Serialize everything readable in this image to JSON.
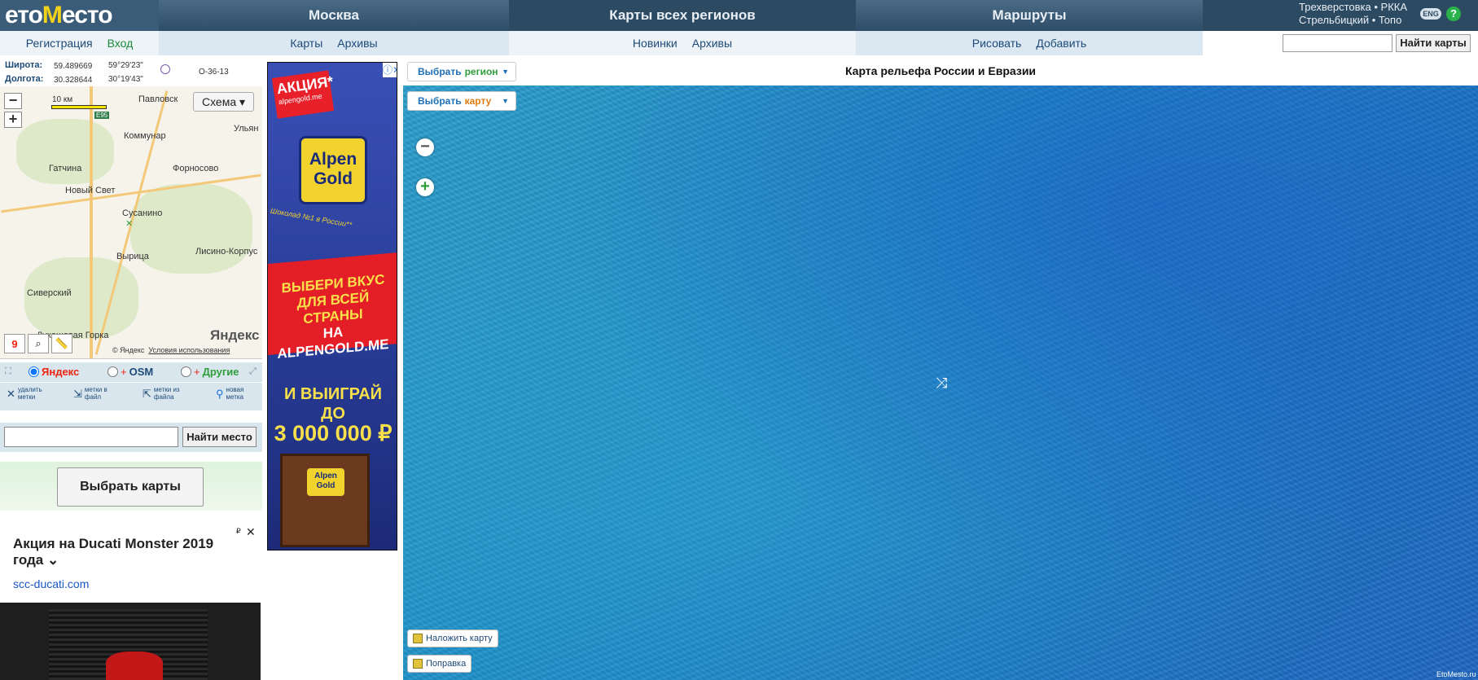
{
  "logo": {
    "text_pre": "е",
    "text_mid": "то",
    "text_hl": "М",
    "text_post": "есто"
  },
  "nav": {
    "moscow": "Москва",
    "all_regions": "Карты всех регионов",
    "routes": "Маршруты",
    "top_right_1": "Трехверстовка • РККА",
    "top_right_2": "Стрельбицкий • Топо",
    "eng": "ENG",
    "help": "?"
  },
  "subnav": {
    "register": "Регистрация",
    "login": "Вход",
    "maps": "Карты",
    "archives1": "Архивы",
    "news": "Новинки",
    "archives2": "Архивы",
    "draw": "Рисовать",
    "add": "Добавить",
    "search_btn": "Найти карты"
  },
  "coords": {
    "lat_label": "Широта:",
    "lat_dec": "59.489669",
    "lat_dms": "59°29'23\"",
    "lon_label": "Долгота:",
    "lon_dec": "30.328644",
    "lon_dms": "30°19'43\"",
    "sheet": "O-36-13"
  },
  "minimap": {
    "scale": "10 км",
    "road": "E95",
    "schema": "Схема ▾",
    "towns": [
      "Павловск",
      "Ульян",
      "Коммунар",
      "Гатчина",
      "Форносово",
      "Новый Свет",
      "Сусанино",
      "Вырица",
      "Лисино-Корпус",
      "Сиверский",
      "Лукашовая Горка"
    ],
    "logo": "Яндекс",
    "copy": "© Яндекс",
    "terms": "Условия использования"
  },
  "providers": {
    "yandex": "Яндекс",
    "osm": "OSM",
    "other": "Другие"
  },
  "tools": [
    {
      "l1": "удалить",
      "l2": "метки"
    },
    {
      "l1": "метки в",
      "l2": "файл"
    },
    {
      "l1": "метки из",
      "l2": "файла"
    },
    {
      "l1": "новая",
      "l2": "метка"
    }
  ],
  "place": {
    "btn": "Найти место"
  },
  "choose_maps": "Выбрать карты",
  "ad": {
    "title": "Акция на Ducati Monster 2019 года",
    "url": "scc-ducati.com",
    "mark": "₽",
    "close": "✕"
  },
  "banner": {
    "akc": "АКЦИЯ*",
    "akc_site": "alpengold.me",
    "brand1": "Alpen",
    "brand2": "Gold",
    "slogan": "Шоколад №1 в России**",
    "red1": "ВЫБЕРИ ВКУС",
    "red2": "ДЛЯ ВСЕЙ СТРАНЫ",
    "red3": "НА ALPENGOLD.ME",
    "win1": "И ВЫИГРАЙ ДО",
    "win2": "3 000 000 ₽",
    "choc": "Alpen Gold",
    "ad_icons": "ⓘ✕"
  },
  "map": {
    "title": "Карта рельефа России и Евразии",
    "sel_region_a": "Выбрать",
    "sel_region_b": "регион",
    "sel_map_a": "Выбрать",
    "sel_map_b": "карту",
    "overlay": "Наложить карту",
    "fix": "Поправка",
    "watermark": "EtoMesto.ru"
  }
}
